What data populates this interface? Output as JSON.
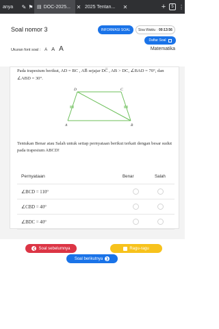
{
  "browser": {
    "tabs": [
      {
        "label": "anya",
        "active": false
      },
      {
        "label": "DOC-2025...",
        "active": true
      },
      {
        "label": "2025  Tentan...",
        "active": false
      }
    ],
    "tab_count": "5",
    "icons": [
      "pencil-icon",
      "flag-icon",
      "pin-icon",
      "document-icon",
      "close-icon",
      "add-icon",
      "tabs-icon",
      "menu-icon"
    ]
  },
  "header": {
    "title": "Soal nomor 3",
    "info_button": "INFORMASI SOAL",
    "timer_label": "Sisa Waktu :",
    "timer_value": "00:13:56",
    "daftar_button": "Daftar Soal",
    "font_size_label": "Ukuran font soal :",
    "font_sizes": [
      "A",
      "A",
      "A"
    ],
    "subject": "Matematika"
  },
  "question": {
    "intro": "Pada trapesium berikut, AD = BC , AB̅ sejajar DC̅ ,   AB > DC, ∠BAD = 70°, dan ∠ABD = 30°.",
    "diagram_labels": {
      "A": "A",
      "B": "B",
      "C": "C",
      "D": "D"
    },
    "instruction": "Tentukan Benar atau Salah untuk setiap pernyataan berikut terkait dengan besar sudut pada trapesium ABCD!",
    "table": {
      "headers": [
        "Pernyataan",
        "Benar",
        "Salah"
      ],
      "rows": [
        {
          "statement": "∠BCD = 110°",
          "benar": false,
          "salah": false
        },
        {
          "statement": "∠CBD = 40°",
          "benar": false,
          "salah": false
        },
        {
          "statement": "∠BDC = 40°",
          "benar": false,
          "salah": false
        }
      ]
    }
  },
  "nav": {
    "prev_label": "Soal sebelumnya",
    "doubt_label": "Ragu-ragu",
    "next_label": "Soal berikutnya"
  },
  "colors": {
    "primary": "#1a73e8",
    "danger": "#dc3545",
    "warning": "#f7c21c",
    "diagram": "#6cbf5a"
  }
}
